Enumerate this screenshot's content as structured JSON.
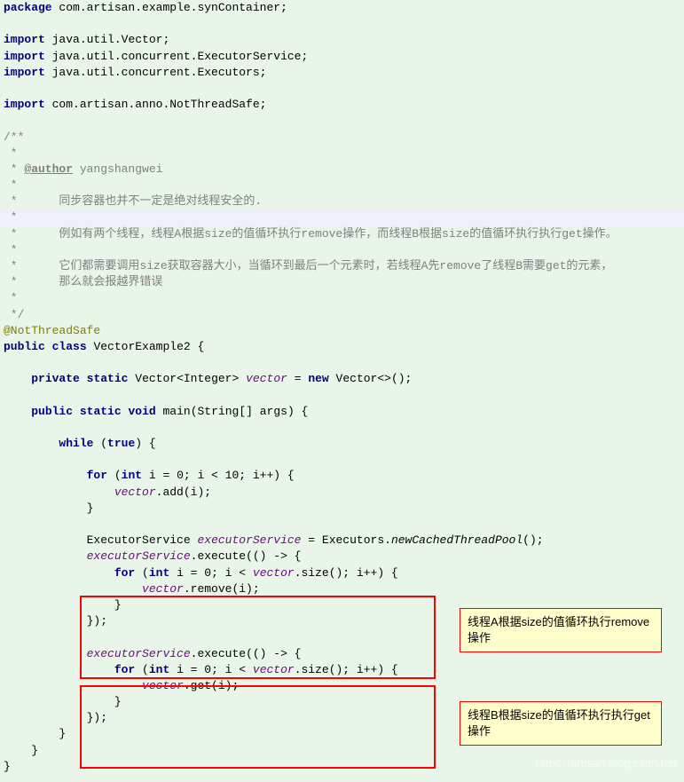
{
  "tokens": {
    "package": "package",
    "import": "import",
    "public": "public",
    "class": "class",
    "private": "private",
    "static": "static",
    "void": "void",
    "while": "while",
    "true": "true",
    "for": "for",
    "int": "int",
    "new": "new"
  },
  "pkg_name": "com.artisan.example.synContainer;",
  "imports": {
    "i1": "java.util.Vector;",
    "i2": "java.util.concurrent.ExecutorService;",
    "i3": "java.util.concurrent.Executors;",
    "i4": "com.artisan.anno.NotThreadSafe;"
  },
  "javadoc": {
    "open": "/**",
    "star": " *",
    "star_sp": " * ",
    "author_tag": "@author",
    "author_name": " yangshangwei",
    "line1": " *      同步容器也并不一定是绝对线程安全的.",
    "line2": " *      例如有两个线程，线程A根据size的值循环执行remove操作，而线程B根据size的值循环执行执行get操作。",
    "line3": " *      它们都需要调用size获取容器大小，当循环到最后一个元素时，若线程A先remove了线程B需要get的元素，",
    "line4": " *      那么就会报越界错误",
    "close": " */"
  },
  "annotation": "@NotThreadSafe",
  "class_name": "VectorExample2",
  "field_decl": {
    "type": "Vector<Integer>",
    "name": "vector",
    "init": "Vector<>();"
  },
  "main": {
    "sig_open": "main(String[] ",
    "args": "args",
    "sig_close": ") {",
    "while_cond": ") {",
    "for_outer": "i = 0; i < 10; i++) {",
    "add_call": ".add(i);",
    "exec_decl_type": "ExecutorService",
    "exec_var": "executorService",
    "exec_init_class": "Executors",
    "exec_init_method": "newCachedThreadPool",
    "exec_init_tail": "();",
    "exec_execute": ".execute(() -> {",
    "for_inner_open": "i = 0; i < ",
    "for_inner_size": ".size(); i++) {",
    "remove_call": ".remove(i);",
    "get_call": ".get(i);",
    "lambda_close": "});"
  },
  "braces": {
    "open": "{",
    "close": "}"
  },
  "callouts": {
    "a": "线程A根据size的值循环执行remove操作",
    "b": "线程B根据size的值循环执行执行get操作"
  },
  "watermark": "https://artisan.blog.csdn.net"
}
